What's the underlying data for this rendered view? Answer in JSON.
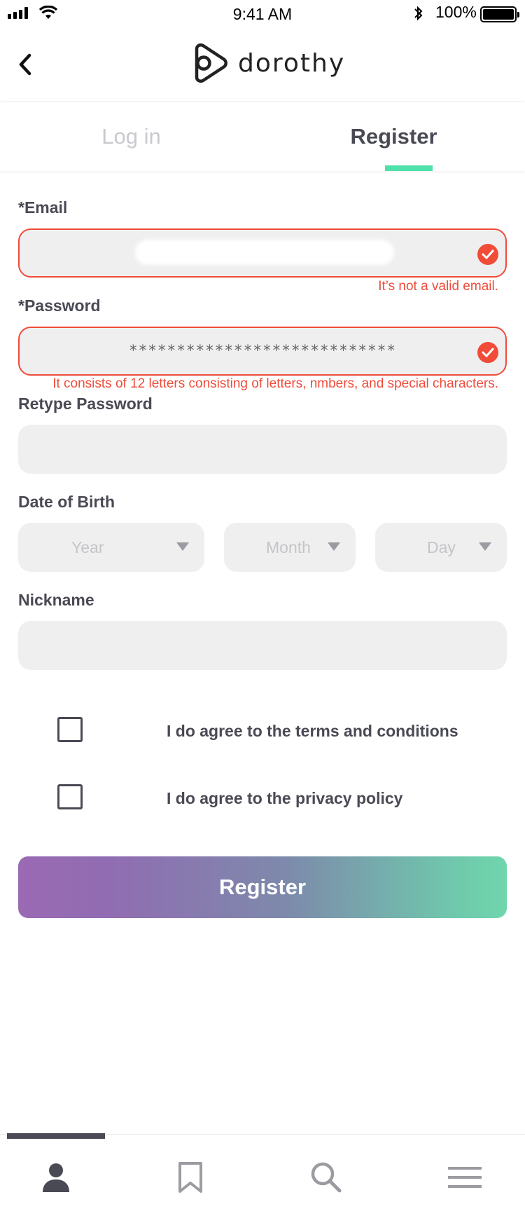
{
  "status_bar": {
    "time": "9:41 AM",
    "battery": "100%"
  },
  "header": {
    "brand": "dorothy"
  },
  "tabs": {
    "login": "Log in",
    "register": "Register"
  },
  "form": {
    "email": {
      "label": "*Email",
      "error": "It’s not a valid email."
    },
    "password": {
      "label": "*Password",
      "value": "****************************",
      "error": "It consists of 12 letters consisting of letters, nmbers, and special characters."
    },
    "retype": {
      "label": "Retype Password"
    },
    "dob": {
      "label": "Date of Birth",
      "year": "Year",
      "month": "Month",
      "day": "Day"
    },
    "nickname": {
      "label": "Nickname"
    },
    "terms": "I do agree to the terms and conditions",
    "privacy": "I do agree to the privacy policy",
    "submit": "Register"
  },
  "colors": {
    "accent": "#4fe0ab",
    "error": "#ef4b3a",
    "text": "#4a4a55",
    "field": "#efefef",
    "gradient_start": "#9a6ab3",
    "gradient_end": "#6fd6ad"
  },
  "tab_bar": {
    "icons": [
      "person-icon",
      "bookmark-icon",
      "search-icon",
      "menu-icon"
    ],
    "active": "person-icon"
  }
}
